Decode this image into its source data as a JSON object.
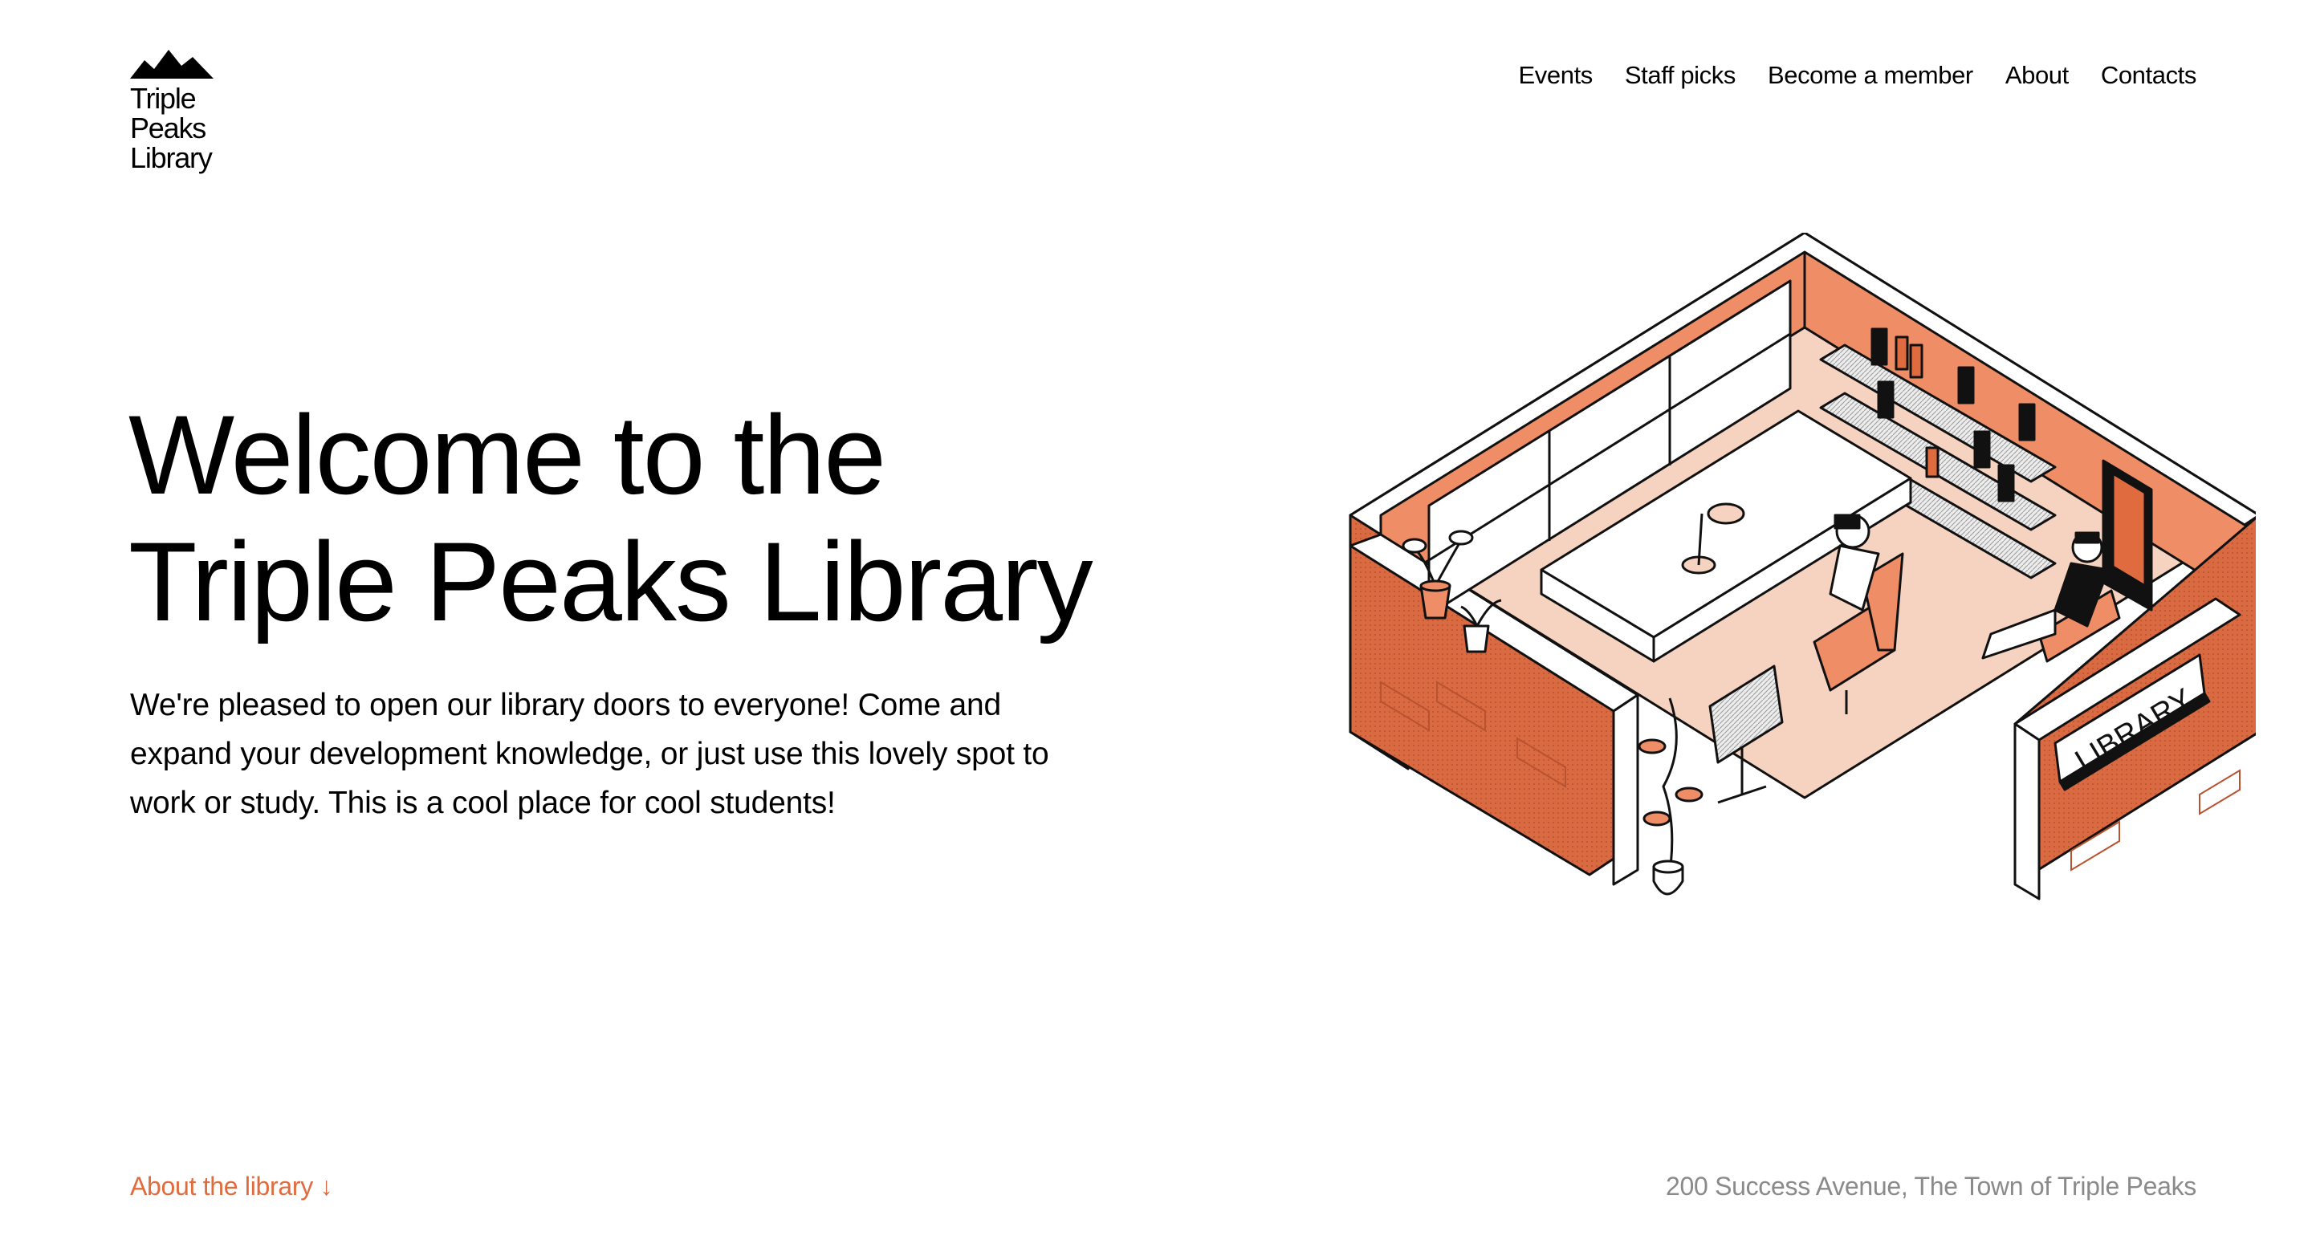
{
  "brand": {
    "logo_icon": "mountain-peaks-icon",
    "line1": "Triple",
    "line2": "Peaks",
    "line3": "Library"
  },
  "nav": {
    "items": [
      "Events",
      "Staff picks",
      "Become a member",
      "About",
      "Contacts"
    ]
  },
  "hero": {
    "title_line1": "Welcome to the",
    "title_line2": "Triple Peaks Library",
    "intro": "We're pleased to open our library doors to everyone! Come and expand your development knowledge, or just use this lovely spot to work or study. This is a cool place for cool students!"
  },
  "illustration": {
    "sign_text": "LIBRARY"
  },
  "footer": {
    "about_link": "About the library ↓",
    "address": "200 Success Avenue, The Town of Triple Peaks"
  },
  "colors": {
    "accent": "#e06b3e",
    "muted_text": "#8a8a8a",
    "wall": "#ef8e66",
    "wall_dark": "#dd7048",
    "floor": "#f6d3c1"
  }
}
